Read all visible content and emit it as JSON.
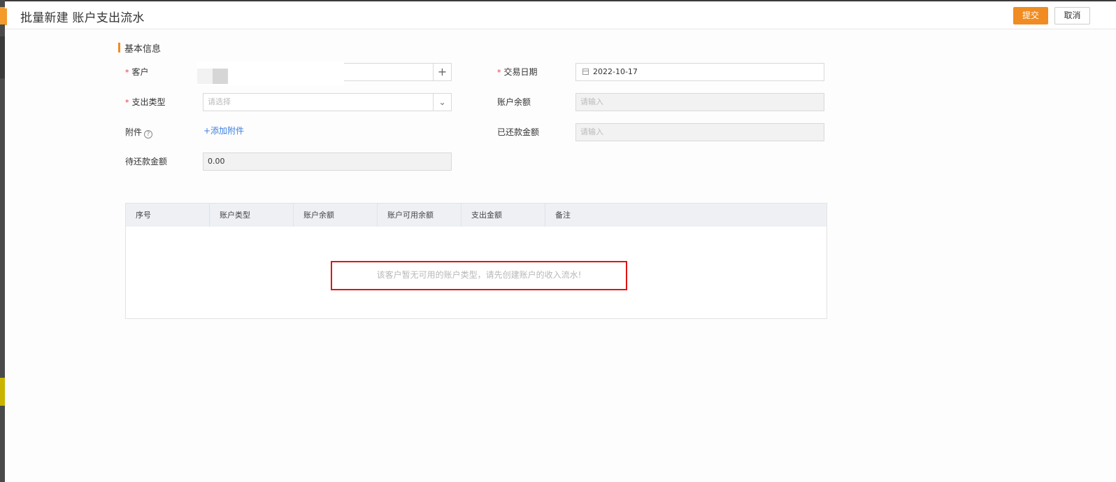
{
  "window": {
    "title": "批量新建 账户支出流水"
  },
  "header": {
    "submit_label": "提交",
    "cancel_label": "取消"
  },
  "section": {
    "title": "基本信息"
  },
  "form": {
    "customer": {
      "label": "客户",
      "required": "*",
      "add_icon": "plus-icon"
    },
    "trade_date": {
      "label": "交易日期",
      "required": "*",
      "value": "2022-10-17",
      "icon": "calendar-icon"
    },
    "expense_type": {
      "label": "支出类型",
      "required": "*",
      "placeholder": "请选择",
      "icon": "chevron-down-icon"
    },
    "account_balance": {
      "label": "账户余额",
      "placeholder": "请输入"
    },
    "attachment": {
      "label": "附件",
      "help_icon": "question-circle-icon",
      "help_glyph": "?",
      "add_link": "+添加附件"
    },
    "repaid_amount": {
      "label": "已还款金额",
      "placeholder": "请输入"
    },
    "pending_amount": {
      "label": "待还款金额",
      "value": "0.00"
    }
  },
  "table": {
    "columns": [
      "序号",
      "账户类型",
      "账户余额",
      "账户可用余额",
      "支出金额",
      "备注"
    ],
    "empty_text": "该客户暂无可用的账户类型，请先创建账户的收入流水!"
  },
  "colors": {
    "accent": "#f08c21",
    "required": "#e4393c",
    "link": "#3d7fe0",
    "highlight_box": "#e01414"
  }
}
